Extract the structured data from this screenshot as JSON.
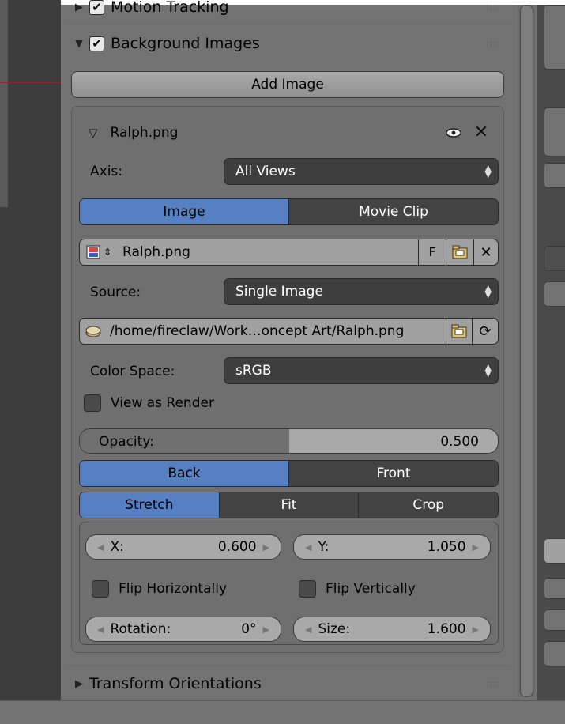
{
  "sections": {
    "motion_tracking": "Motion Tracking",
    "background_images": "Background Images",
    "transform_orientations": "Transform Orientations"
  },
  "add_image_label": "Add Image",
  "image_item": {
    "name": "Ralph.png",
    "axis_label": "Axis:",
    "axis_value": "All Views",
    "type_tabs": [
      "Image",
      "Movie Clip"
    ],
    "datablock_name": "Ralph.png",
    "fake_user_label": "F",
    "source_label": "Source:",
    "source_value": "Single Image",
    "filepath": "/home/fireclaw/Work…oncept Art/Ralph.png",
    "color_space_label": "Color Space:",
    "color_space_value": "sRGB",
    "view_as_render": "View as Render",
    "opacity_label": "Opacity:",
    "opacity_value": "0.500",
    "opacity_fraction": 0.5,
    "depth_tabs": [
      "Back",
      "Front"
    ],
    "frame_tabs": [
      "Stretch",
      "Fit",
      "Crop"
    ],
    "x_label": "X:",
    "x_value": "0.600",
    "y_label": "Y:",
    "y_value": "1.050",
    "flip_h": "Flip Horizontally",
    "flip_v": "Flip Vertically",
    "rotation_label": "Rotation:",
    "rotation_value": "0°",
    "size_label": "Size:",
    "size_value": "1.600"
  },
  "icons": {
    "eye": "eye-icon",
    "close": "close-icon",
    "image_type": "image-icon",
    "folder": "folder-icon",
    "reload": "reload-icon",
    "file": "file-icon"
  },
  "colors": {
    "accent": "#5680c2",
    "panel": "#727272",
    "field_dark": "#3e3e3e"
  }
}
